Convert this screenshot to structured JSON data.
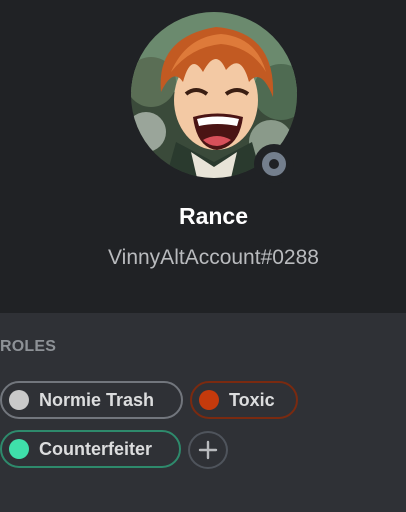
{
  "profile": {
    "display_name": "Rance",
    "username": "VinnyAltAccount#0288",
    "avatar_icon": "anime-character-avatar",
    "status": "offline",
    "status_color": "#747f8d"
  },
  "roles": {
    "heading": "ROLES",
    "items": [
      {
        "label": "Normie Trash",
        "color": "#c9c9c9",
        "border": "#72767d"
      },
      {
        "label": "Toxic",
        "color": "#c43a0c",
        "border": "#7a2a10"
      },
      {
        "label": "Counterfeiter",
        "color": "#3fdfaa",
        "border": "#2e8a6c"
      }
    ],
    "add_icon": "plus-icon"
  },
  "colors": {
    "header_bg": "#202225",
    "panel_bg": "#2f3136",
    "name_text": "#ffffff",
    "muted_text": "#b9bbbe"
  }
}
